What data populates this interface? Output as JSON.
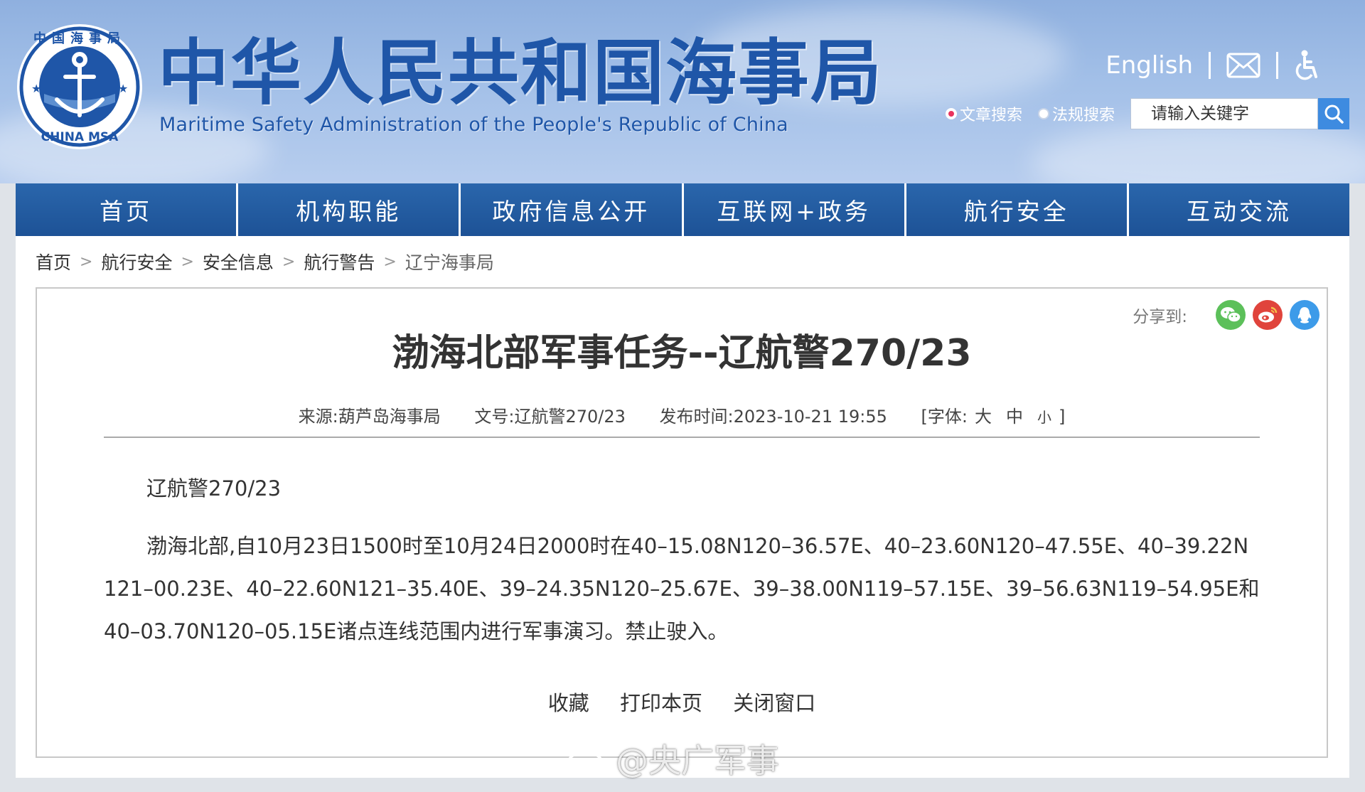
{
  "header": {
    "title_cn": "中华人民共和国海事局",
    "title_en": "Maritime Safety Administration of the People's Republic of China",
    "logo_ring_text": "中国海事局",
    "logo_bottom_text": "CHINA MSA",
    "language_link": "English",
    "search": {
      "option_article": "文章搜索",
      "option_law": "法规搜索",
      "selected": "文章搜索",
      "placeholder": "请输入关键字"
    }
  },
  "nav": [
    {
      "label": "首页"
    },
    {
      "label": "机构职能"
    },
    {
      "label": "政府信息公开"
    },
    {
      "label": "互联网+政务"
    },
    {
      "label": "航行安全"
    },
    {
      "label": "互动交流"
    }
  ],
  "breadcrumb": [
    "首页",
    "航行安全",
    "安全信息",
    "航行警告",
    "辽宁海事局"
  ],
  "article": {
    "share_label": "分享到:",
    "title": "渤海北部军事任务--辽航警270/23",
    "meta": {
      "source": "来源:葫芦岛海事局",
      "doc_no": "文号:辽航警270/23",
      "publish_time": "发布时间:2023-10-21 19:55",
      "font_size_label": "[字体:",
      "font_large": "大",
      "font_medium": "中",
      "font_small": "小",
      "font_close": "]"
    },
    "para1": "辽航警270/23",
    "para2": "渤海北部,自10月23日1500时至10月24日2000时在40–15.08N120–36.57E、40–23.60N120–47.55E、40–39.22N121–00.23E、40–22.60N121–35.40E、39–24.35N120–25.67E、39–38.00N119–57.15E、39–56.63N119–54.95E和40–03.70N120–05.15E诸点连线范围内进行军事演习。禁止驶入。",
    "actions": {
      "favorite": "收藏",
      "print": "打印本页",
      "close": "关闭窗口"
    }
  },
  "watermark": "@央广军事",
  "colors": {
    "nav_blue": "#1d5296",
    "title_blue": "#1f56a8",
    "wechat_green": "#5cc05a",
    "weibo_red": "#e0443c",
    "qq_blue": "#3d9be9",
    "search_blue": "#3e8be0"
  }
}
